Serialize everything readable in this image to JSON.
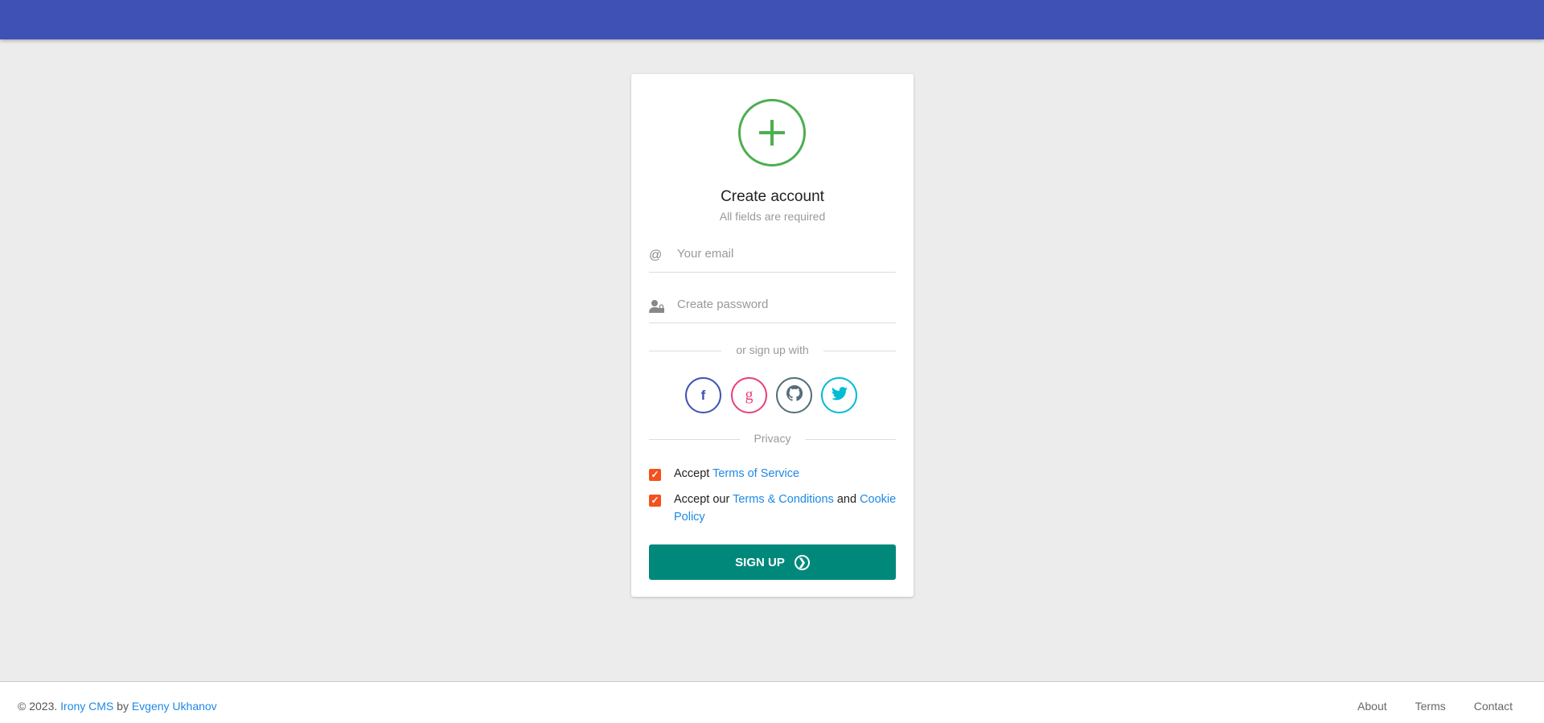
{
  "card": {
    "title": "Create account",
    "subtitle": "All fields are required",
    "email_placeholder": "Your email",
    "password_placeholder": "Create password",
    "social_divider": "or sign up with",
    "social": [
      {
        "name": "facebook",
        "glyph": "f",
        "color": "#3f51b5"
      },
      {
        "name": "google",
        "glyph": "g",
        "color": "#ec407a"
      },
      {
        "name": "github",
        "glyph": "◉",
        "color": "#546e7a"
      },
      {
        "name": "twitter",
        "glyph": "🐦",
        "color": "#00bcd4"
      }
    ],
    "privacy_divider": "Privacy",
    "accept1_prefix": "Accept ",
    "accept1_link": "Terms of Service",
    "accept2_prefix": "Accept our ",
    "accept2_link1": "Terms & Conditions",
    "accept2_mid": " and ",
    "accept2_link2": "Cookie Policy",
    "checkbox1_checked": true,
    "checkbox2_checked": true,
    "signup_label": "SIGN UP"
  },
  "footer": {
    "copyright": "© 2023. ",
    "brand": "Irony CMS",
    "by": " by ",
    "author": "Evgeny Ukhanov",
    "links": [
      "About",
      "Terms",
      "Contact"
    ]
  },
  "colors": {
    "navbar": "#3f51b5",
    "accent": "#4caf50",
    "button": "#00897b",
    "checkbox": "#f4511e",
    "link": "#1e88e5"
  }
}
